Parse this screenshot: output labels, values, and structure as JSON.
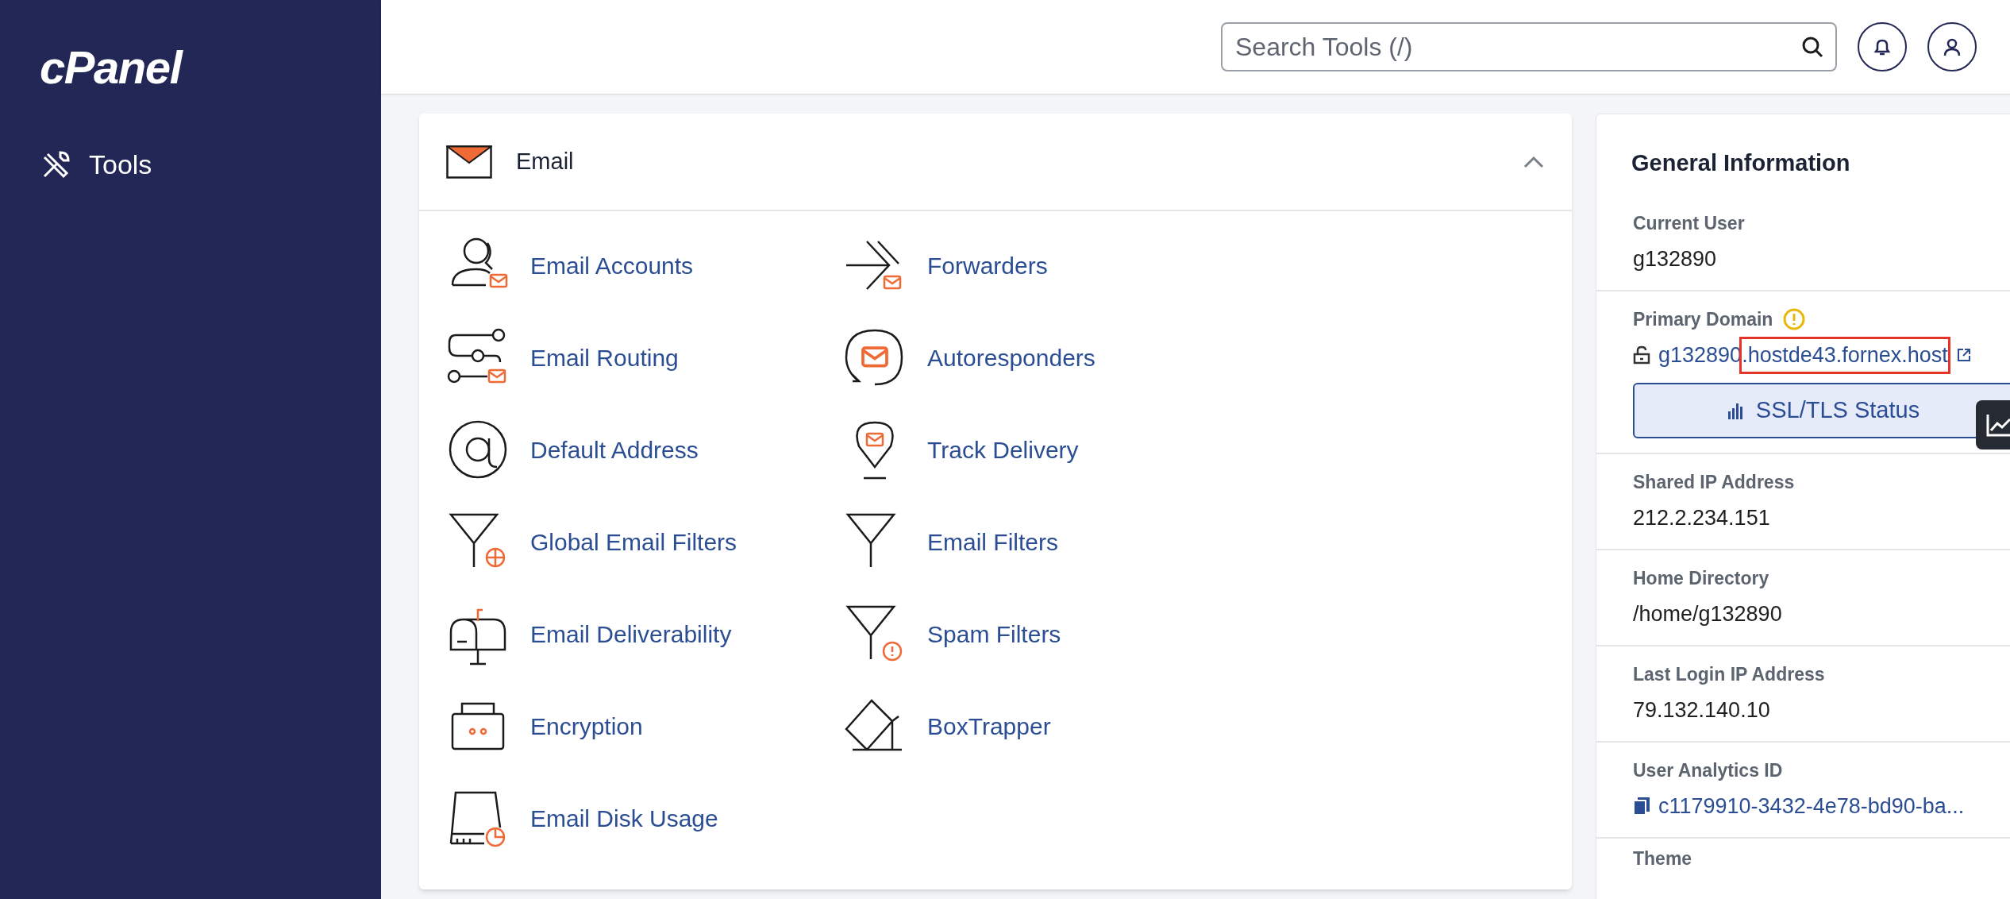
{
  "sidebar": {
    "logo": "cPanel",
    "items": [
      {
        "label": "Tools",
        "selected": false
      }
    ]
  },
  "header": {
    "search": {
      "placeholder": "Search Tools (/)"
    }
  },
  "email_section": {
    "title": "Email",
    "expanded": true,
    "columns": [
      [
        {
          "label": "Email Accounts"
        },
        {
          "label": "Email Routing"
        },
        {
          "label": "Default Address"
        },
        {
          "label": "Global Email Filters"
        },
        {
          "label": "Email Deliverability"
        },
        {
          "label": "Encryption"
        },
        {
          "label": "Email Disk Usage"
        }
      ],
      [
        {
          "label": "Forwarders"
        },
        {
          "label": "Autoresponders"
        },
        {
          "label": "Track Delivery"
        },
        {
          "label": "Email Filters"
        },
        {
          "label": "Spam Filters"
        },
        {
          "label": "BoxTrapper"
        }
      ]
    ]
  },
  "general_information": {
    "title": "General Information",
    "rows": [
      {
        "kind": "text",
        "label": "Current User",
        "value": "g132890"
      },
      {
        "kind": "domain",
        "label": "Primary Domain",
        "warning": true,
        "parts": [
          {
            "text": "g132890",
            "highlighted": false
          },
          {
            "text": ".hostde43.fornex.host",
            "highlighted": true
          }
        ],
        "button": "SSL/TLS Status"
      },
      {
        "kind": "text",
        "label": "Shared IP Address",
        "value": "212.2.234.151"
      },
      {
        "kind": "text",
        "label": "Home Directory",
        "value": "/home/g132890"
      },
      {
        "kind": "text",
        "label": "Last Login IP Address",
        "value": "79.132.140.10"
      },
      {
        "kind": "copy",
        "label": "User Analytics ID",
        "value": "c1179910-3432-4e78-bd90-ba..."
      },
      {
        "kind": "heading",
        "label": "Theme"
      }
    ]
  }
}
